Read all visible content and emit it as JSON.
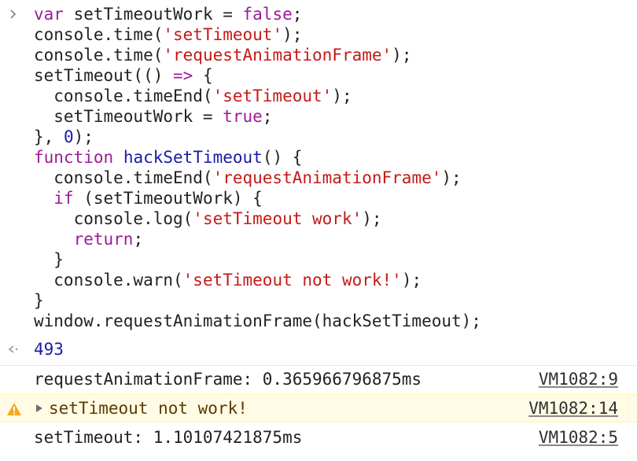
{
  "colors": {
    "keyword": "#9d1b98",
    "function_name": "#1a1aa6",
    "string": "#c41a16",
    "number": "#1a1aa6",
    "warning_bg": "#fffbe5",
    "warning_text": "#5c3c00",
    "warning_icon": "#f2ab26"
  },
  "input": {
    "prompt_icon": "chevron-right-icon",
    "lines": [
      [
        {
          "t": "var",
          "k": "kw"
        },
        {
          "t": " setTimeoutWork = ",
          "k": "plain"
        },
        {
          "t": "false",
          "k": "bool"
        },
        {
          "t": ";",
          "k": "plain"
        }
      ],
      [
        {
          "t": "console.time(",
          "k": "plain"
        },
        {
          "t": "'setTimeout'",
          "k": "str"
        },
        {
          "t": ");",
          "k": "plain"
        }
      ],
      [
        {
          "t": "console.time(",
          "k": "plain"
        },
        {
          "t": "'requestAnimationFrame'",
          "k": "str"
        },
        {
          "t": ");",
          "k": "plain"
        }
      ],
      [
        {
          "t": "setTimeout(() ",
          "k": "plain"
        },
        {
          "t": "=>",
          "k": "arrow"
        },
        {
          "t": " {",
          "k": "plain"
        }
      ],
      [
        {
          "t": "  console.timeEnd(",
          "k": "plain"
        },
        {
          "t": "'setTimeout'",
          "k": "str"
        },
        {
          "t": ");",
          "k": "plain"
        }
      ],
      [
        {
          "t": "  setTimeoutWork = ",
          "k": "plain"
        },
        {
          "t": "true",
          "k": "bool"
        },
        {
          "t": ";",
          "k": "plain"
        }
      ],
      [
        {
          "t": "}, ",
          "k": "plain"
        },
        {
          "t": "0",
          "k": "num"
        },
        {
          "t": ");",
          "k": "plain"
        }
      ],
      [
        {
          "t": "function",
          "k": "kw"
        },
        {
          "t": " ",
          "k": "plain"
        },
        {
          "t": "hackSetTimeout",
          "k": "fn"
        },
        {
          "t": "() {",
          "k": "plain"
        }
      ],
      [
        {
          "t": "  console.timeEnd(",
          "k": "plain"
        },
        {
          "t": "'requestAnimationFrame'",
          "k": "str"
        },
        {
          "t": ");",
          "k": "plain"
        }
      ],
      [
        {
          "t": "  ",
          "k": "plain"
        },
        {
          "t": "if",
          "k": "kw"
        },
        {
          "t": " (setTimeoutWork) {",
          "k": "plain"
        }
      ],
      [
        {
          "t": "    console.log(",
          "k": "plain"
        },
        {
          "t": "'setTimeout work'",
          "k": "str"
        },
        {
          "t": ");",
          "k": "plain"
        }
      ],
      [
        {
          "t": "    ",
          "k": "plain"
        },
        {
          "t": "return",
          "k": "kw"
        },
        {
          "t": ";",
          "k": "plain"
        }
      ],
      [
        {
          "t": "  }",
          "k": "plain"
        }
      ],
      [
        {
          "t": "  console.warn(",
          "k": "plain"
        },
        {
          "t": "'setTimeout not work!'",
          "k": "str"
        },
        {
          "t": ");",
          "k": "plain"
        }
      ],
      [
        {
          "t": "}",
          "k": "plain"
        }
      ],
      [
        {
          "t": "window.requestAnimationFrame(hackSetTimeout);",
          "k": "plain"
        }
      ]
    ]
  },
  "result": {
    "icon": "return-arrow-icon",
    "value": "493"
  },
  "logs": [
    {
      "type": "log",
      "message": "requestAnimationFrame: 0.365966796875ms",
      "source": "VM1082:9"
    },
    {
      "type": "warn",
      "icon": "warning-icon",
      "message": "setTimeout not work!",
      "source": "VM1082:14"
    },
    {
      "type": "log",
      "message": "setTimeout: 1.10107421875ms",
      "source": "VM1082:5"
    }
  ]
}
